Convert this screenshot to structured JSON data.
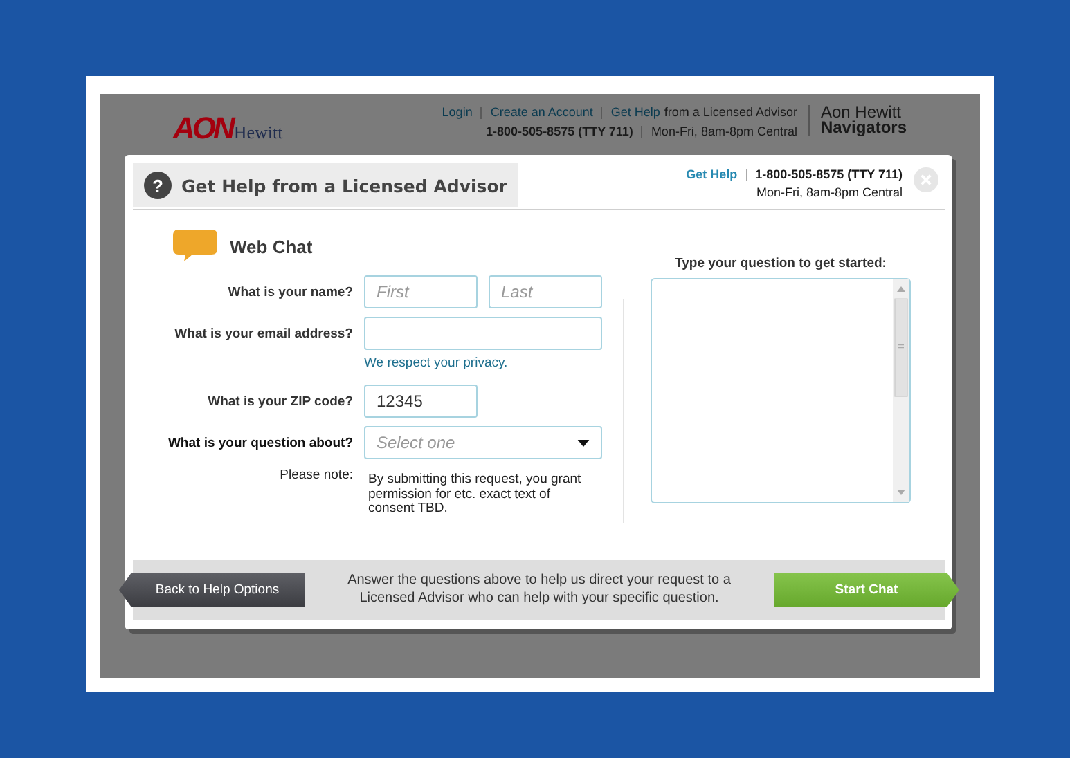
{
  "header": {
    "logo": {
      "mark": "AON",
      "name": "Hewitt"
    },
    "links": [
      {
        "label": "Login"
      },
      {
        "label": "Create an Account"
      }
    ],
    "get_help": "Get Help",
    "get_help_rest": "from a Licensed Advisor",
    "phone": "1-800-505-8575 (TTY 711)",
    "hours": "Mon-Fri, 8am-8pm Central",
    "brand": {
      "top": "Aon Hewitt",
      "bottom": "Navigators"
    }
  },
  "modal": {
    "help_icon": "?",
    "title": "Get Help from a Licensed Advisor",
    "help_link": "Get Help",
    "phone": "1-800-505-8575 (TTY 711)",
    "hours": "Mon-Fri, 8am-8pm Central",
    "section_title": "Web Chat",
    "fields": [
      {
        "kind": "name",
        "label": "What is your name?",
        "first_placeholder": "First",
        "last_placeholder": "Last"
      },
      {
        "kind": "email",
        "label": "What is your email address?",
        "note": "We respect your privacy."
      },
      {
        "kind": "text",
        "label": "What is your ZIP code?",
        "value": "12345"
      },
      {
        "kind": "select",
        "label": "What is your question about?",
        "placeholder": "Select one"
      },
      {
        "kind": "note",
        "label": "Please note:",
        "text": "By submitting this request, you grant permission for etc. exact text of consent TBD."
      }
    ],
    "question_label": "Type your question to get started:",
    "footer": {
      "back": "Back to Help Options",
      "message": "Answer the questions above to help us direct your request to a Licensed Advisor who can help with your specific question.",
      "start": "Start Chat"
    }
  }
}
